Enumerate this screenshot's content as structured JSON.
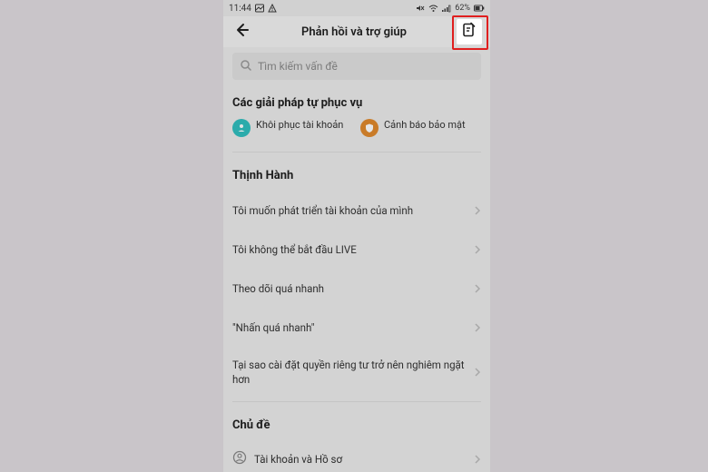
{
  "statusbar": {
    "time": "11:44",
    "battery_pct": "62%"
  },
  "header": {
    "title": "Phản hồi và trợ giúp"
  },
  "search": {
    "placeholder": "Tìm kiếm vấn đề"
  },
  "self_service": {
    "title": "Các giải pháp tự phục vụ",
    "items": [
      {
        "label": "Khôi phục tài khoản",
        "icon": "recover-account-icon",
        "color": "teal"
      },
      {
        "label": "Cảnh báo bảo mật",
        "icon": "security-alert-icon",
        "color": "orange"
      }
    ]
  },
  "trending": {
    "title": "Thịnh Hành",
    "items": [
      "Tôi muốn phát triển tài khoản của mình",
      "Tôi không thể bắt đầu LIVE",
      "Theo dõi quá nhanh",
      "\"Nhấn quá nhanh\"",
      "Tại sao cài đặt quyền riêng tư trở nên nghiêm ngặt hơn"
    ]
  },
  "topics": {
    "title": "Chủ đề",
    "items": [
      "Tài khoản và Hồ sơ"
    ]
  }
}
